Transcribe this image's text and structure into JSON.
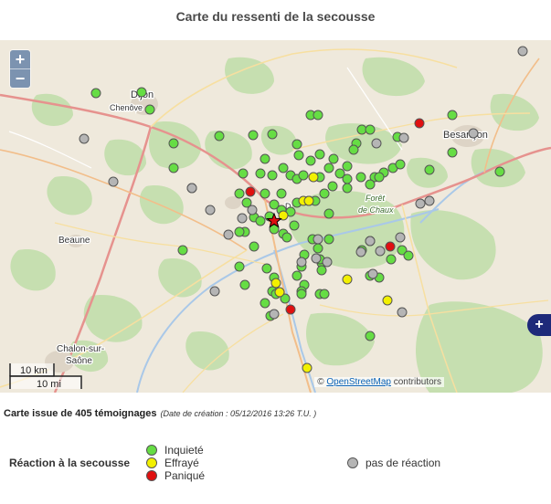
{
  "title": "Carte du ressenti de la secousse",
  "map": {
    "zoom_in": "+",
    "zoom_out": "−",
    "side_button": "+",
    "labels": {
      "dijon": "Dijon",
      "chenove": "Chenôve",
      "besancon": "Besançon",
      "beaune": "Beaune",
      "chalon1": "Chalon-sur-",
      "chalon2": "Saône",
      "foret1": "Forêt",
      "foret2": "de Chaux",
      "d": "D"
    },
    "scale": {
      "km": "10 km",
      "mi": "10 mi"
    },
    "attribution": {
      "prefix": "©",
      "link": "OpenStreetMap",
      "suffix": " contributors"
    },
    "colors": {
      "inquiete": "#66dd44",
      "effraye": "#f2f000",
      "panique": "#e01010",
      "pas": "#b5b5b5",
      "epicenter": "#dd1010"
    }
  },
  "caption": {
    "main": "Carte issue de 405 témoignages",
    "date": "(Date de création : 05/12/2016 13:26 T.U. )"
  },
  "legend": {
    "title": "Réaction à la secousse",
    "inquiete": "Inquieté",
    "effraye": "Effrayé",
    "panique": "Paniqué",
    "pas": "pas de réaction"
  }
}
